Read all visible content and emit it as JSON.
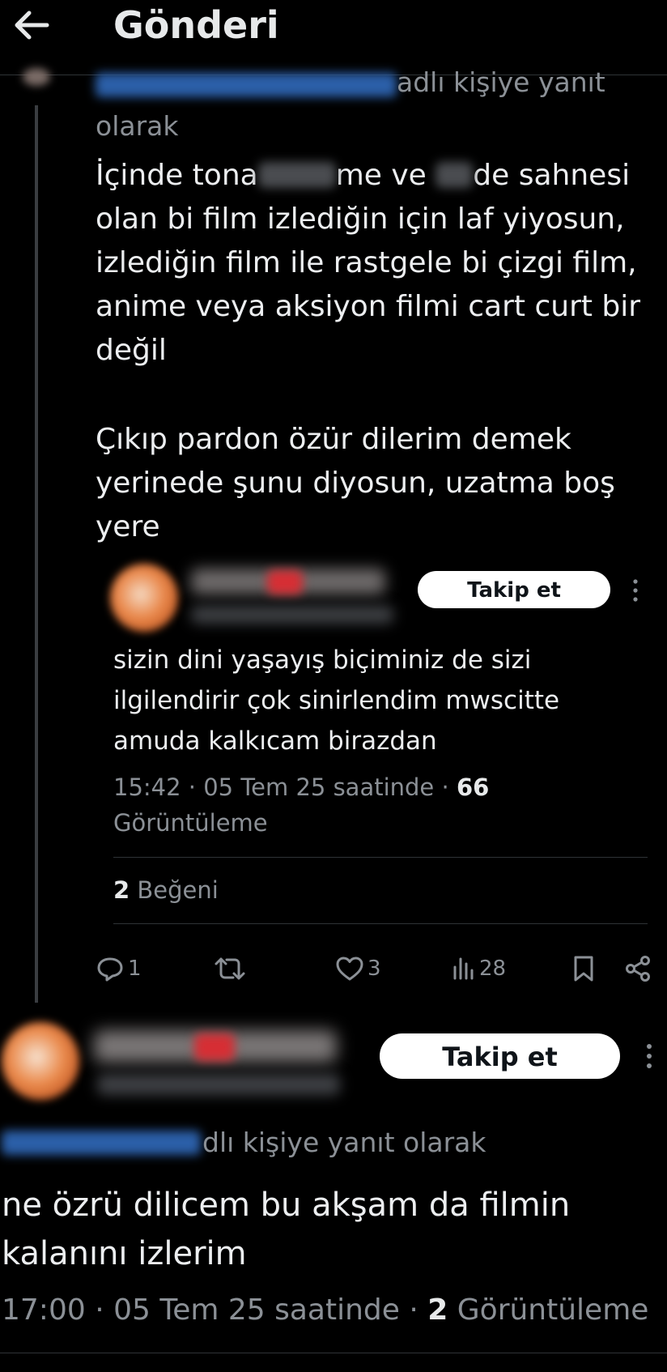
{
  "header": {
    "title": "Gönderi"
  },
  "post": {
    "reply_to_suffix": "adlı kişiye yanıt",
    "reply_to_suffix2": "olarak",
    "text_line1_a": "İçinde tona",
    "text_line1_b": "me ve",
    "text_line1_c": "de sahnesi",
    "text_line2": "olan bi film izlediğin için laf yiyosun,",
    "text_line3": "izlediğin film ile rastgele bi çizgi film,",
    "text_line4": "anime veya aksiyon filmi cart curt bir",
    "text_line5": "değil",
    "text_line6": "Çıkıp pardon özür dilerim demek",
    "text_line7": "yerinede şunu diyosun, uzatma boş",
    "text_line8": "yere",
    "actions": {
      "replies": "1",
      "likes": "3",
      "views": "28"
    }
  },
  "quoted": {
    "follow_label": "Takip et",
    "text_line1": "sizin dini yaşayış biçiminiz de sizi",
    "text_line2": "ilgilendirir çok sinirlendim mwscitte",
    "text_line3": "amuda kalkıcam birazdan",
    "meta_time": "15:42 · 05 Tem 25 saatinde · ",
    "meta_views": "66",
    "meta_views_label": "Görüntüleme",
    "likes_count": "2",
    "likes_label": " Beğeni"
  },
  "reply": {
    "follow_label": "Takip et",
    "reply_to_suffix": "dlı kişiye yanıt olarak",
    "text_line1": "ne özrü dilicem bu akşam da filmin",
    "text_line2": "kalanını izlerim",
    "meta_time": "17:00 · 05 Tem 25 saatinde · ",
    "meta_views": "2",
    "meta_views_label": " Görüntüleme"
  },
  "colors": {
    "background": "#000000",
    "text": "#e7e9ea",
    "muted": "#8b9096",
    "blurred_handle": "#2b5fa8"
  },
  "icons": [
    "back-arrow-icon",
    "reply-icon",
    "retweet-icon",
    "heart-icon",
    "views-icon",
    "bookmark-icon",
    "share-icon",
    "more-icon"
  ]
}
